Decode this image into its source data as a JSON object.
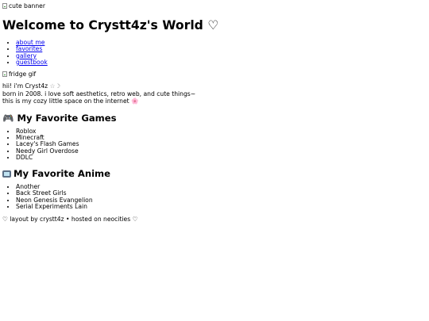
{
  "banner": {
    "alt": "cute banner"
  },
  "header": {
    "title": "Welcome to Crystt4z's World ♡"
  },
  "nav": {
    "items": [
      {
        "label": "about me"
      },
      {
        "label": "favorites"
      },
      {
        "label": "gallery"
      },
      {
        "label": "guestbook"
      }
    ]
  },
  "fridge": {
    "alt": "fridge gif"
  },
  "intro": {
    "line1": "hii! i'm Cryst4z",
    "line1_suffix": "☆☽",
    "line2": "born in 2008. i love soft aesthetics, retro web, and cute things~",
    "line3": "this is my cozy little space on the internet",
    "line3_suffix": "🌸"
  },
  "games": {
    "heading": "My Favorite Games",
    "icon": "gamepad-icon",
    "items": [
      "Roblox",
      "Minecraft",
      "Lacey's Flash Games",
      "Needy Girl Overdose",
      "DDLC"
    ]
  },
  "anime": {
    "heading": "My Favorite Anime",
    "icon": "tv-icon",
    "items": [
      "Another",
      "Back Street Girls",
      "Neon Genesis Evangelion",
      "Serial Experiments Lain"
    ]
  },
  "footer": {
    "text": "♡ layout by crystt4z • hosted on neocities ♡"
  },
  "colors": {
    "link": "#0000ee",
    "text": "#000000",
    "background": "#ffffff"
  }
}
